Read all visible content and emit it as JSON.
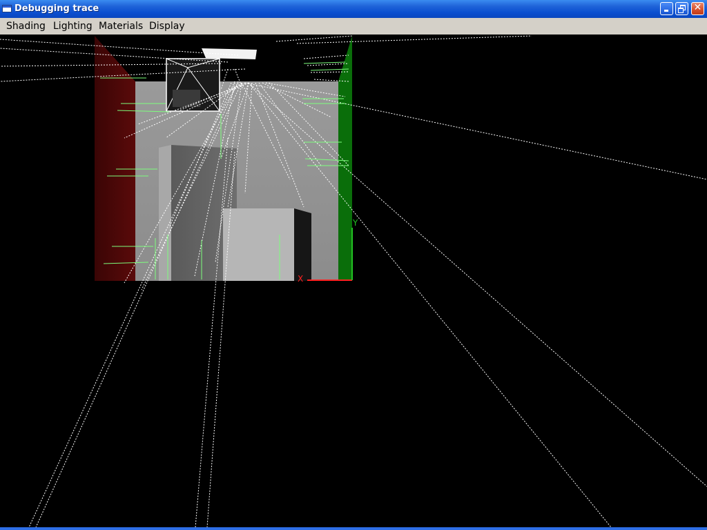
{
  "window": {
    "title": "Debugging trace",
    "icons": {
      "app": "app-window-icon",
      "minimize": "minimize-icon",
      "maximize": "restore-icon",
      "close": "close-icon"
    },
    "close_glyph": "✕"
  },
  "menu": {
    "items": [
      {
        "label": "Shading"
      },
      {
        "label": "Lighting"
      },
      {
        "label": "Materials"
      },
      {
        "label": "Display"
      }
    ]
  },
  "scene": {
    "axis_x_label": "X",
    "axis_y_label": "Y",
    "colors": {
      "background": "#000000",
      "x_axis": "#ff2020",
      "y_axis": "#22c222",
      "left_wall": "#4a0707",
      "right_wall": "#0a6e0a",
      "normals": "#7dff7d",
      "rays": "#ffffff"
    }
  }
}
